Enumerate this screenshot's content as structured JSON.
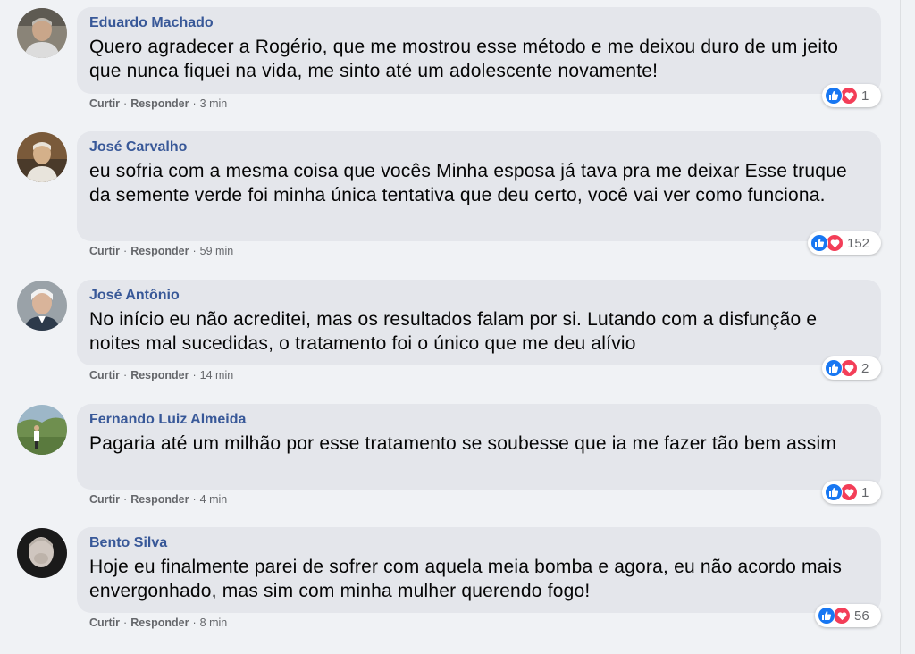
{
  "comments": [
    {
      "author": "Eduardo Machado",
      "text": "Quero agradecer a Rogério, que me mostrou esse método e me deixou duro de um jeito que nunca fiquei na vida, me sinto até um adolescente novamente!",
      "like_label": "Curtir",
      "reply_label": "Responder",
      "time": "3 min",
      "reaction_count": "1",
      "reaction_icons": [
        "like-icon",
        "love-icon"
      ]
    },
    {
      "author": "José Carvalho",
      "text": "eu sofria com a mesma coisa que vocês Minha esposa já tava pra me deixar Esse truque da semente verde foi minha única tentativa que deu certo, você vai ver como funciona.",
      "like_label": "Curtir",
      "reply_label": "Responder",
      "time": "59 min",
      "reaction_count": "152",
      "reaction_icons": [
        "like-icon",
        "love-icon"
      ]
    },
    {
      "author": "José Antônio",
      "text": "No início eu não acreditei, mas os resultados falam por si. Lutando com a disfunção e noites mal sucedidas, o tratamento foi o único que me deu alívio",
      "like_label": "Curtir",
      "reply_label": "Responder",
      "time": "14 min",
      "reaction_count": "2",
      "reaction_icons": [
        "like-icon",
        "love-icon"
      ]
    },
    {
      "author": "Fernando Luiz Almeida",
      "text": "Pagaria até um milhão por esse tratamento se soubesse que ia me fazer tão bem assim",
      "like_label": "Curtir",
      "reply_label": "Responder",
      "time": "4 min",
      "reaction_count": "1",
      "reaction_icons": [
        "like-icon",
        "love-icon"
      ]
    },
    {
      "author": "Bento Silva",
      "text": "Hoje eu finalmente parei de sofrer com aquela meia bomba e agora, eu não acordo mais envergonhado, mas sim com minha mulher querendo fogo!",
      "like_label": "Curtir",
      "reply_label": "Responder",
      "time": "8 min",
      "reaction_count": "56",
      "reaction_icons": [
        "like-icon",
        "love-icon"
      ]
    }
  ],
  "colors": {
    "author_name": "#385898",
    "bubble_bg": "#e4e6eb",
    "page_bg": "#f0f2f5",
    "like_blue": "#1877f2",
    "love_red": "#f33e58"
  }
}
